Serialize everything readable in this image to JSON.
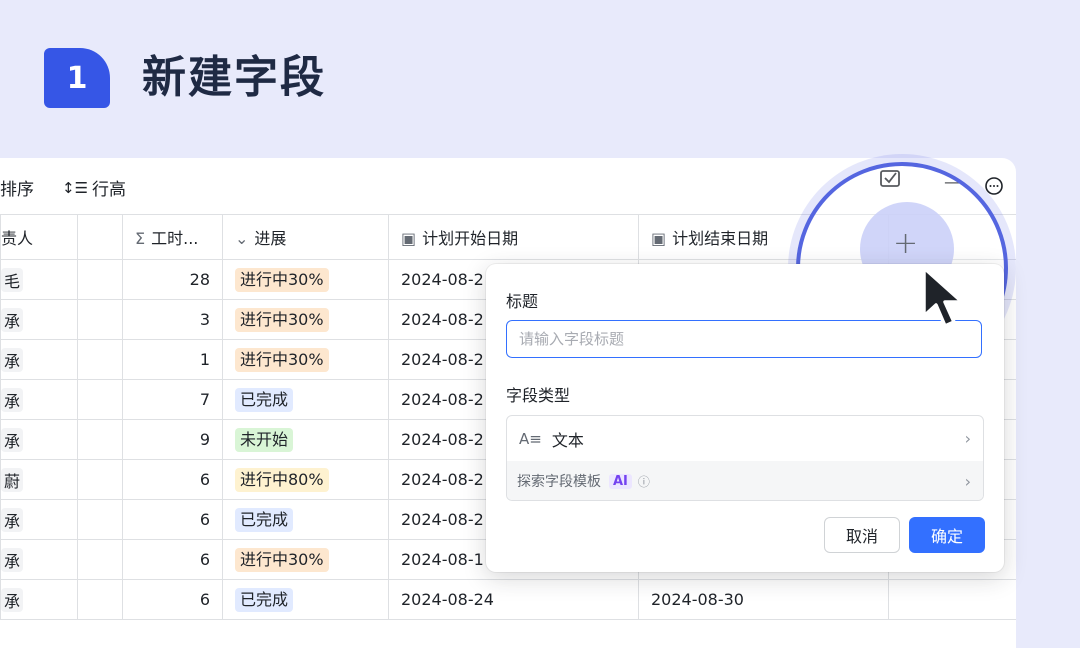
{
  "header": {
    "step_number": "1",
    "title": "新建字段"
  },
  "toolbar": {
    "sort_label": "排序",
    "row_height_label": "行高"
  },
  "columns": [
    {
      "label": "责人",
      "icon": "person-icon"
    },
    {
      "label": "",
      "icon": ""
    },
    {
      "label": "工时...",
      "icon": "sum-icon"
    },
    {
      "label": "进展",
      "icon": "select-icon"
    },
    {
      "label": "计划开始日期",
      "icon": "calendar-icon"
    },
    {
      "label": "计划结束日期",
      "icon": "calendar-icon"
    }
  ],
  "rows": [
    {
      "owner": "毛",
      "hours": "28",
      "progress": "进行中30%",
      "start": "2024-08-2",
      "end": ""
    },
    {
      "owner": "承",
      "hours": "3",
      "progress": "进行中30%",
      "start": "2024-08-2",
      "end": ""
    },
    {
      "owner": "承",
      "hours": "1",
      "progress": "进行中30%",
      "start": "2024-08-2",
      "end": ""
    },
    {
      "owner": "承",
      "hours": "7",
      "progress": "已完成",
      "start": "2024-08-2",
      "end": ""
    },
    {
      "owner": "承",
      "hours": "9",
      "progress": "未开始",
      "start": "2024-08-2",
      "end": ""
    },
    {
      "owner": "蔚",
      "hours": "6",
      "progress": "进行中80%",
      "start": "2024-08-2",
      "end": ""
    },
    {
      "owner": "承",
      "hours": "6",
      "progress": "已完成",
      "start": "2024-08-2",
      "end": ""
    },
    {
      "owner": "承",
      "hours": "6",
      "progress": "进行中30%",
      "start": "2024-08-1",
      "end": ""
    },
    {
      "owner": "承",
      "hours": "6",
      "progress": "已完成",
      "start": "2024-08-24",
      "end": "2024-08-30"
    }
  ],
  "tag_colors": {
    "进行中30%": {
      "bg": "#fde7cf",
      "fg": "#1f2329"
    },
    "进行中80%": {
      "bg": "#fef2d0",
      "fg": "#1f2329"
    },
    "已完成": {
      "bg": "#e1eaff",
      "fg": "#1f2329"
    },
    "未开始": {
      "bg": "#d9f5d6",
      "fg": "#1f2329"
    }
  },
  "dialog": {
    "title_label": "标题",
    "title_placeholder": "请输入字段标题",
    "type_label": "字段类型",
    "type_value": "文本",
    "template_label": "探索字段模板",
    "ai_badge": "AI",
    "cancel_label": "取消",
    "ok_label": "确定"
  },
  "accent_color": "#3370ff"
}
